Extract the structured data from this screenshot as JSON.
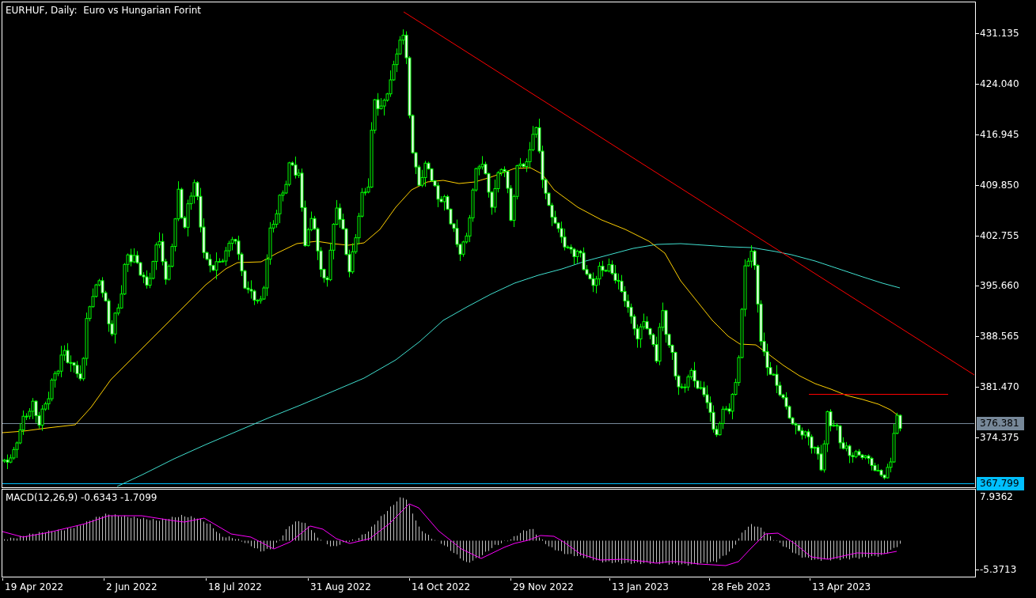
{
  "chart": {
    "title": "EURHUF, Daily:  Euro vs Hungarian Forint"
  },
  "price_axis": {
    "ticks": [
      "431.135",
      "424.040",
      "416.945",
      "409.850",
      "402.755",
      "395.660",
      "388.565",
      "381.470",
      "374.375"
    ],
    "tags": [
      {
        "value": "376.381",
        "color": "#778899"
      },
      {
        "value": "367.799",
        "color": "#00bfff"
      }
    ]
  },
  "macd": {
    "label": "MACD(12,26,9) -0.6343 -1.7099",
    "scale": [
      "7.9362",
      "-5.3713"
    ]
  },
  "date_axis": [
    "19 Apr 2022",
    "2 Jun 2022",
    "18 Jul 2022",
    "31 Aug 2022",
    "14 Oct 2022",
    "29 Nov 2022",
    "13 Jan 2023",
    "28 Feb 2023",
    "13 Apr 2023"
  ]
}
